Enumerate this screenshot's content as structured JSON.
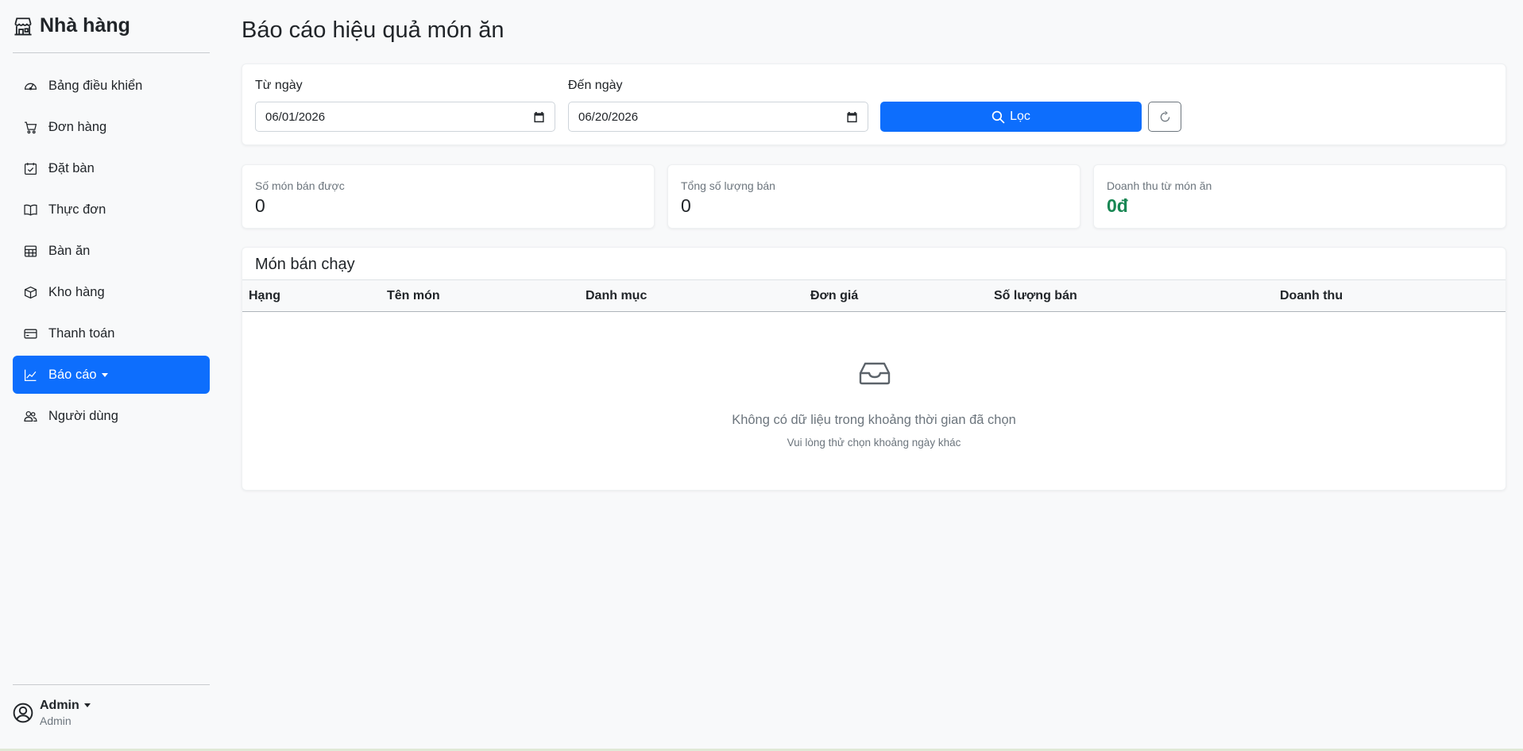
{
  "sidebar": {
    "brand": "Nhà hàng",
    "items": [
      {
        "label": "Bảng điều khiển",
        "icon": "dashboard-icon"
      },
      {
        "label": "Đơn hàng",
        "icon": "cart-icon"
      },
      {
        "label": "Đặt bàn",
        "icon": "calendar-check-icon"
      },
      {
        "label": "Thực đơn",
        "icon": "book-icon"
      },
      {
        "label": "Bàn ăn",
        "icon": "table-icon"
      },
      {
        "label": "Kho hàng",
        "icon": "box-icon"
      },
      {
        "label": "Thanh toán",
        "icon": "credit-card-icon"
      },
      {
        "label": "Báo cáo",
        "icon": "chart-line-icon",
        "active": true
      },
      {
        "label": "Người dùng",
        "icon": "people-icon"
      }
    ],
    "user": {
      "name": "Admin",
      "role": "Admin"
    }
  },
  "page": {
    "title": "Báo cáo hiệu quả món ăn"
  },
  "filter": {
    "from_label": "Từ ngày",
    "from_value": "06/01/2026",
    "to_label": "Đến ngày",
    "to_value": "06/20/2026",
    "filter_button": "Lọc"
  },
  "stats": [
    {
      "label": "Số món bán được",
      "value": "0"
    },
    {
      "label": "Tổng số lượng bán",
      "value": "0"
    },
    {
      "label": "Doanh thu từ món ăn",
      "value": "0đ",
      "color": "#198754"
    }
  ],
  "table": {
    "title": "Món bán chạy",
    "columns": [
      "Hạng",
      "Tên món",
      "Danh mục",
      "Đơn giá",
      "Số lượng bán",
      "Doanh thu"
    ],
    "empty_title": "Không có dữ liệu trong khoảng thời gian đã chọn",
    "empty_subtitle": "Vui lòng thử chọn khoảng ngày khác"
  },
  "colors": {
    "primary": "#0d6efd",
    "success": "#198754",
    "muted": "#6c757d"
  }
}
